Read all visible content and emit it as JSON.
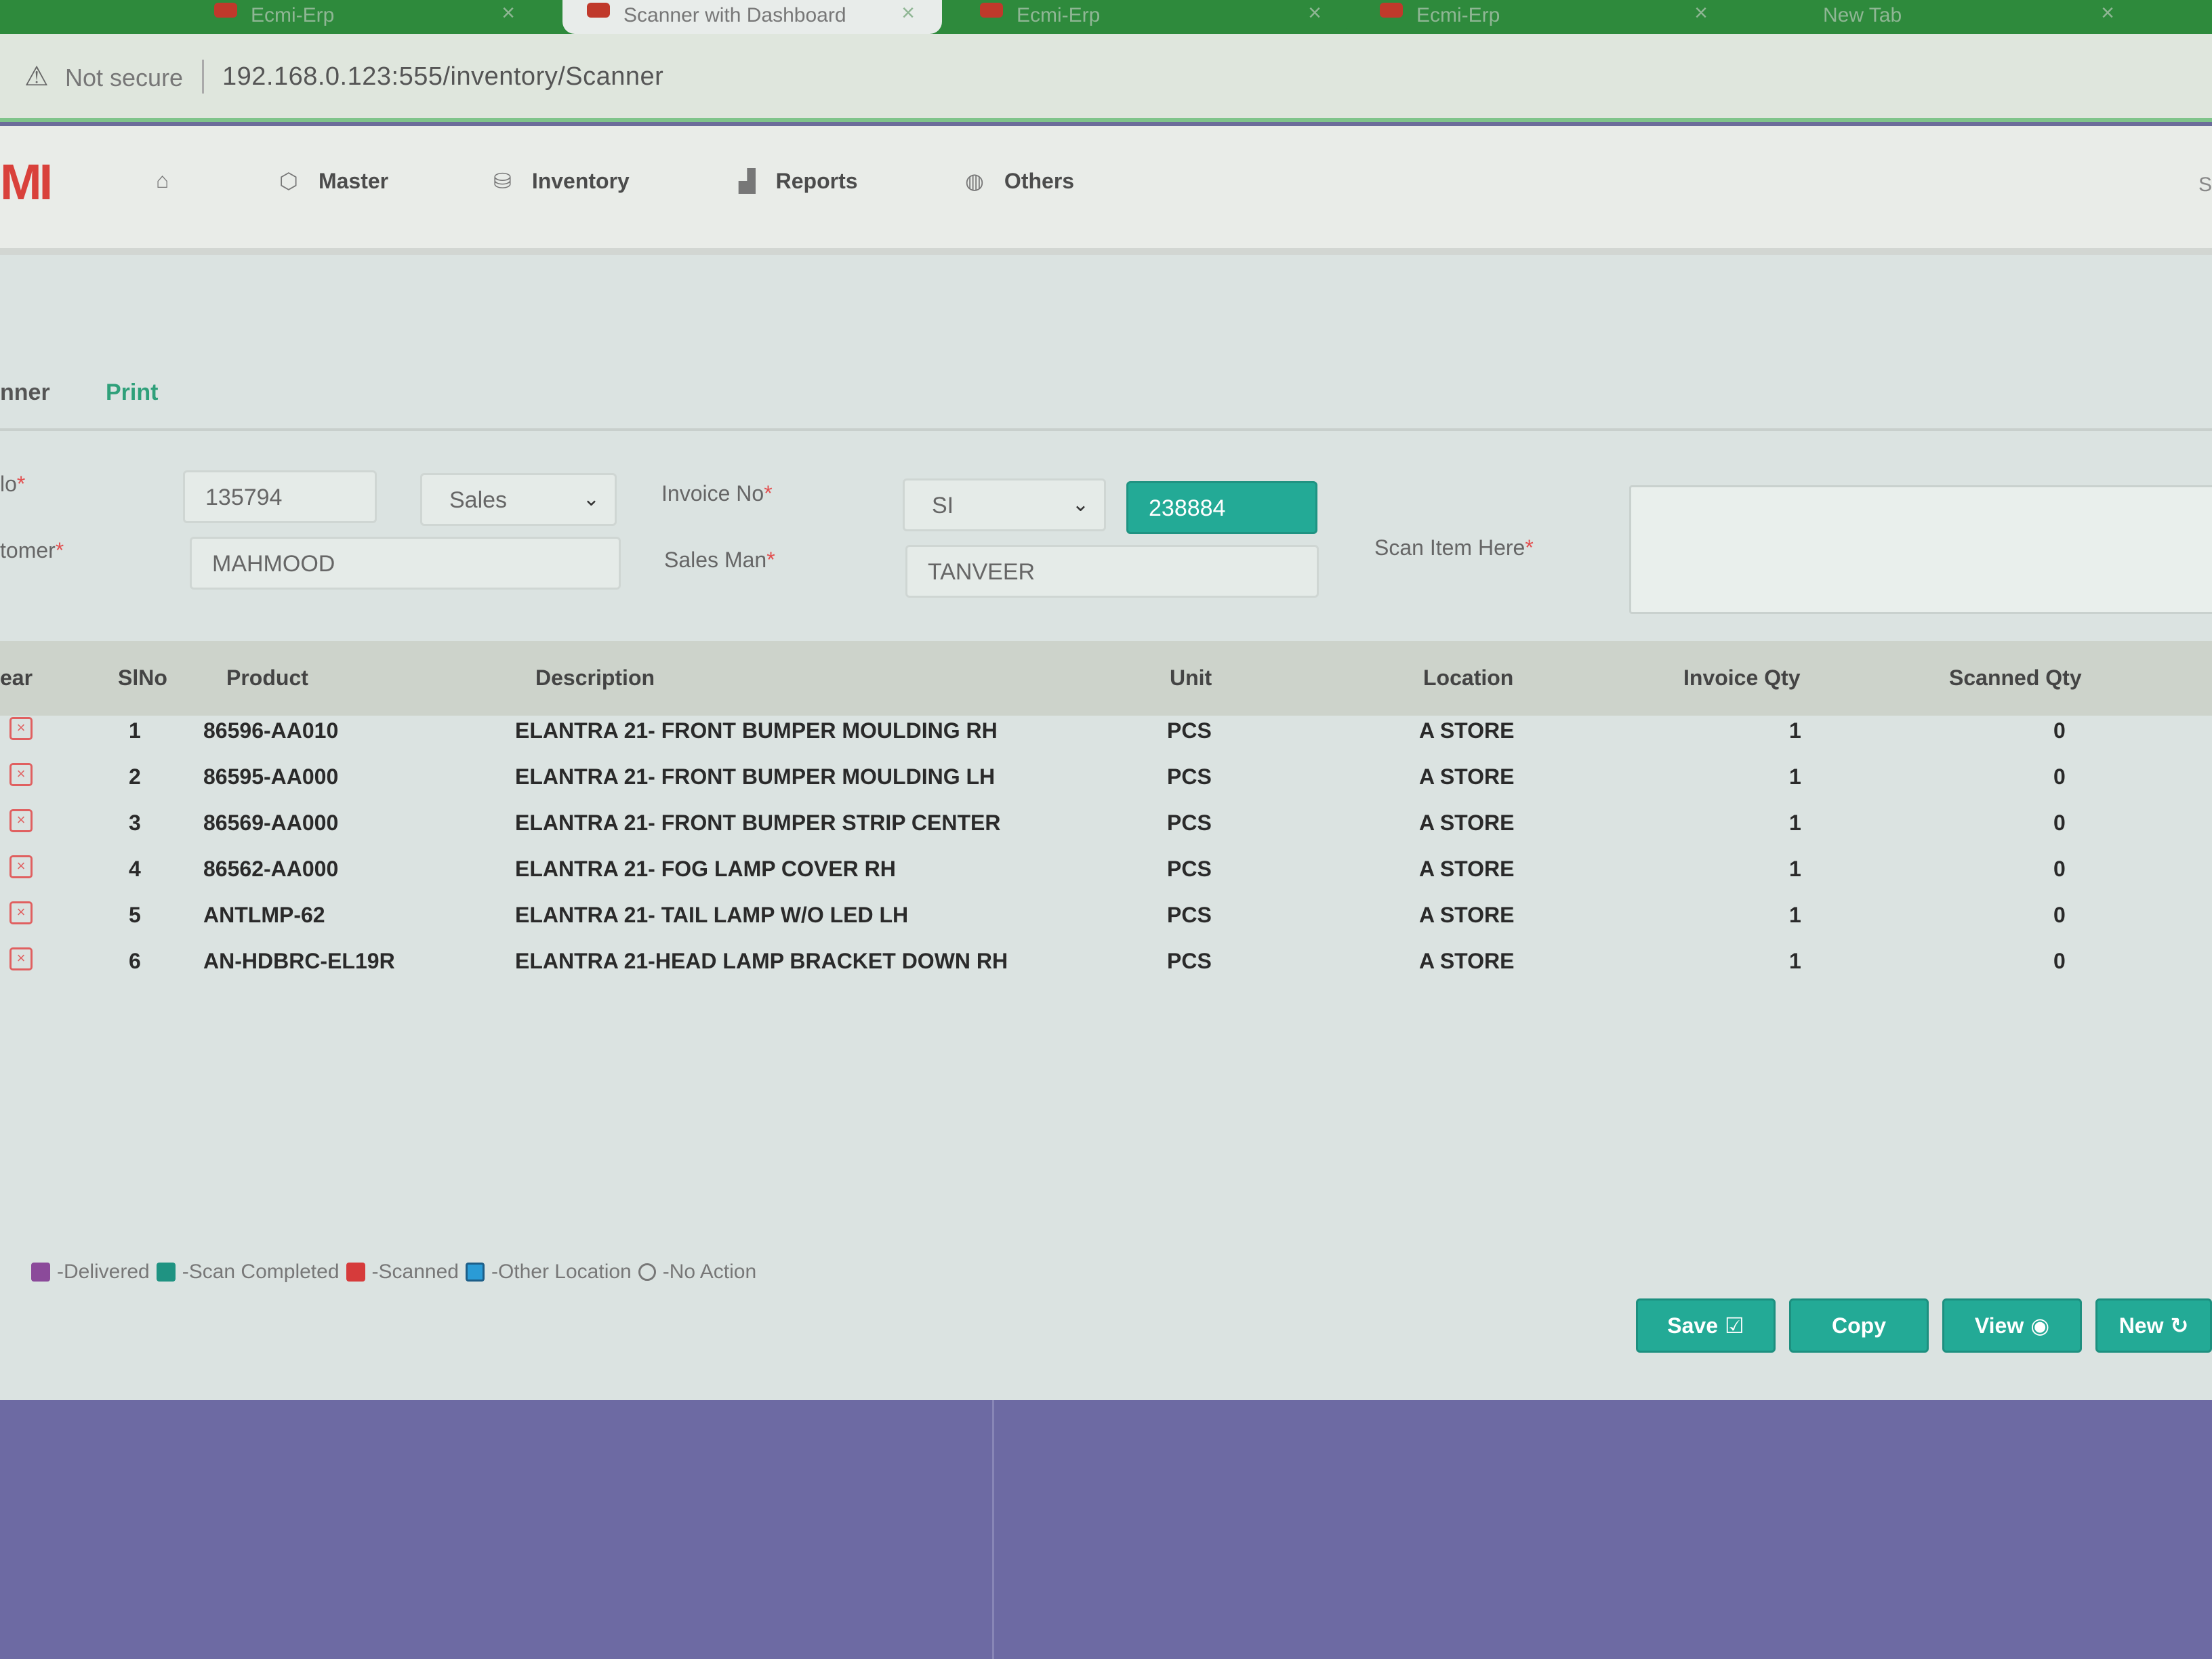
{
  "browser": {
    "tabs": [
      {
        "label": "Ecmi-Erp"
      },
      {
        "label": "Scanner with Dashboard"
      },
      {
        "label": "Ecmi-Erp"
      },
      {
        "label": "Ecmi-Erp"
      },
      {
        "label": "New Tab"
      }
    ],
    "security_label": "Not secure",
    "url": "192.168.0.123:555/inventory/Scanner"
  },
  "nav": {
    "logo": "MI",
    "items": [
      {
        "label": "Master"
      },
      {
        "label": "Inventory"
      },
      {
        "label": "Reports"
      },
      {
        "label": "Others"
      }
    ],
    "right_text": "S"
  },
  "subtabs": [
    {
      "label": "nner"
    },
    {
      "label": "Print"
    }
  ],
  "form": {
    "no_label": "lo",
    "no_value": "135794",
    "type_value": "Sales",
    "invoice_no_label": "Invoice No",
    "invoice_prefix_value": "SI",
    "invoice_number_value": "238884",
    "customer_label": "tomer",
    "customer_value": "MAHMOOD",
    "salesman_label": "Sales Man",
    "salesman_value": "TANVEER",
    "scan_label": "Scan Item Here",
    "required_mark": "*"
  },
  "table": {
    "headers": {
      "clear": "ear",
      "slno": "SlNo",
      "product": "Product",
      "description": "Description",
      "unit": "Unit",
      "location": "Location",
      "invoice_qty": "Invoice Qty",
      "scanned_qty": "Scanned Qty"
    },
    "rows": [
      {
        "slno": "1",
        "product": "86596-AA010",
        "description": "ELANTRA 21- FRONT BUMPER MOULDING RH",
        "unit": "PCS",
        "location": "A STORE",
        "invoice_qty": "1",
        "scanned_qty": "0"
      },
      {
        "slno": "2",
        "product": "86595-AA000",
        "description": "ELANTRA 21- FRONT BUMPER MOULDING LH",
        "unit": "PCS",
        "location": "A STORE",
        "invoice_qty": "1",
        "scanned_qty": "0"
      },
      {
        "slno": "3",
        "product": "86569-AA000",
        "description": "ELANTRA 21- FRONT BUMPER STRIP CENTER",
        "unit": "PCS",
        "location": "A STORE",
        "invoice_qty": "1",
        "scanned_qty": "0"
      },
      {
        "slno": "4",
        "product": "86562-AA000",
        "description": "ELANTRA 21- FOG LAMP COVER RH",
        "unit": "PCS",
        "location": "A STORE",
        "invoice_qty": "1",
        "scanned_qty": "0"
      },
      {
        "slno": "5",
        "product": "ANTLMP-62",
        "description": "ELANTRA 21- TAIL LAMP W/O LED LH",
        "unit": "PCS",
        "location": "A STORE",
        "invoice_qty": "1",
        "scanned_qty": "0"
      },
      {
        "slno": "6",
        "product": "AN-HDBRC-EL19R",
        "description": "ELANTRA 21-HEAD LAMP BRACKET DOWN RH",
        "unit": "PCS",
        "location": "A STORE",
        "invoice_qty": "1",
        "scanned_qty": "0"
      }
    ]
  },
  "legend": [
    {
      "label": "-Delivered",
      "color": "#8b4a9a"
    },
    {
      "label": "-Scan Completed",
      "color": "#1f9382"
    },
    {
      "label": "-Scanned",
      "color": "#d63b3b"
    },
    {
      "label": "-Other Location",
      "color": "#2a9bd6"
    },
    {
      "label": "-No Action",
      "color": "#777777"
    }
  ],
  "actions": {
    "save": "Save",
    "copy": "Copy",
    "view": "View",
    "new": "New"
  },
  "colors": {
    "accent": "#23aa96",
    "brand": "#d9413b",
    "browser_green": "#2e8a3c"
  }
}
